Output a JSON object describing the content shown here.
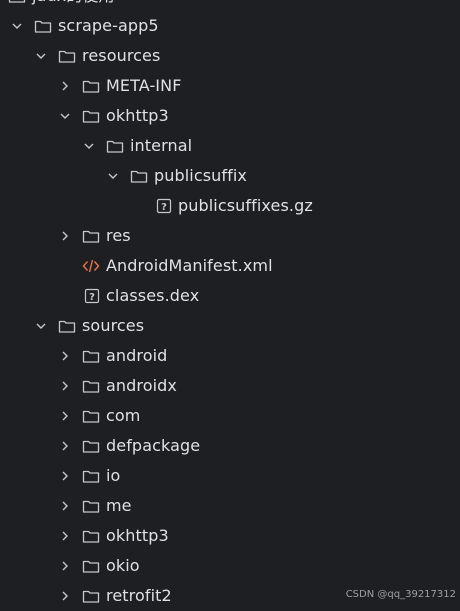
{
  "tree": {
    "rows": [
      {
        "label": "jadx的使用",
        "icon": "folder-icon",
        "expanded": null
      },
      {
        "label": "scrape-app5",
        "icon": "folder-icon",
        "expanded": true
      },
      {
        "label": "resources",
        "icon": "folder-icon",
        "expanded": true
      },
      {
        "label": "META-INF",
        "icon": "folder-icon",
        "expanded": false
      },
      {
        "label": "okhttp3",
        "icon": "folder-icon",
        "expanded": true
      },
      {
        "label": "internal",
        "icon": "folder-icon",
        "expanded": true
      },
      {
        "label": "publicsuffix",
        "icon": "folder-icon",
        "expanded": true
      },
      {
        "label": "publicsuffixes.gz",
        "icon": "unknown-file-icon",
        "expanded": null
      },
      {
        "label": "res",
        "icon": "folder-icon",
        "expanded": false
      },
      {
        "label": "AndroidManifest.xml",
        "icon": "xml-file-icon",
        "expanded": null
      },
      {
        "label": "classes.dex",
        "icon": "unknown-file-icon",
        "expanded": null
      },
      {
        "label": "sources",
        "icon": "folder-icon",
        "expanded": true
      },
      {
        "label": "android",
        "icon": "folder-icon",
        "expanded": false
      },
      {
        "label": "androidx",
        "icon": "folder-icon",
        "expanded": false
      },
      {
        "label": "com",
        "icon": "folder-icon",
        "expanded": false
      },
      {
        "label": "defpackage",
        "icon": "folder-icon",
        "expanded": false
      },
      {
        "label": "io",
        "icon": "folder-icon",
        "expanded": false
      },
      {
        "label": "me",
        "icon": "folder-icon",
        "expanded": false
      },
      {
        "label": "okhttp3",
        "icon": "folder-icon",
        "expanded": false
      },
      {
        "label": "okio",
        "icon": "folder-icon",
        "expanded": false
      },
      {
        "label": "retrofit2",
        "icon": "folder-icon",
        "expanded": false
      }
    ]
  },
  "watermark": "CSDN @qq_39217312",
  "colors": {
    "background": "#1e1f22",
    "text": "#dfe1e5",
    "icon": "#c5c8ce",
    "xml_icon": "#e8754a"
  }
}
